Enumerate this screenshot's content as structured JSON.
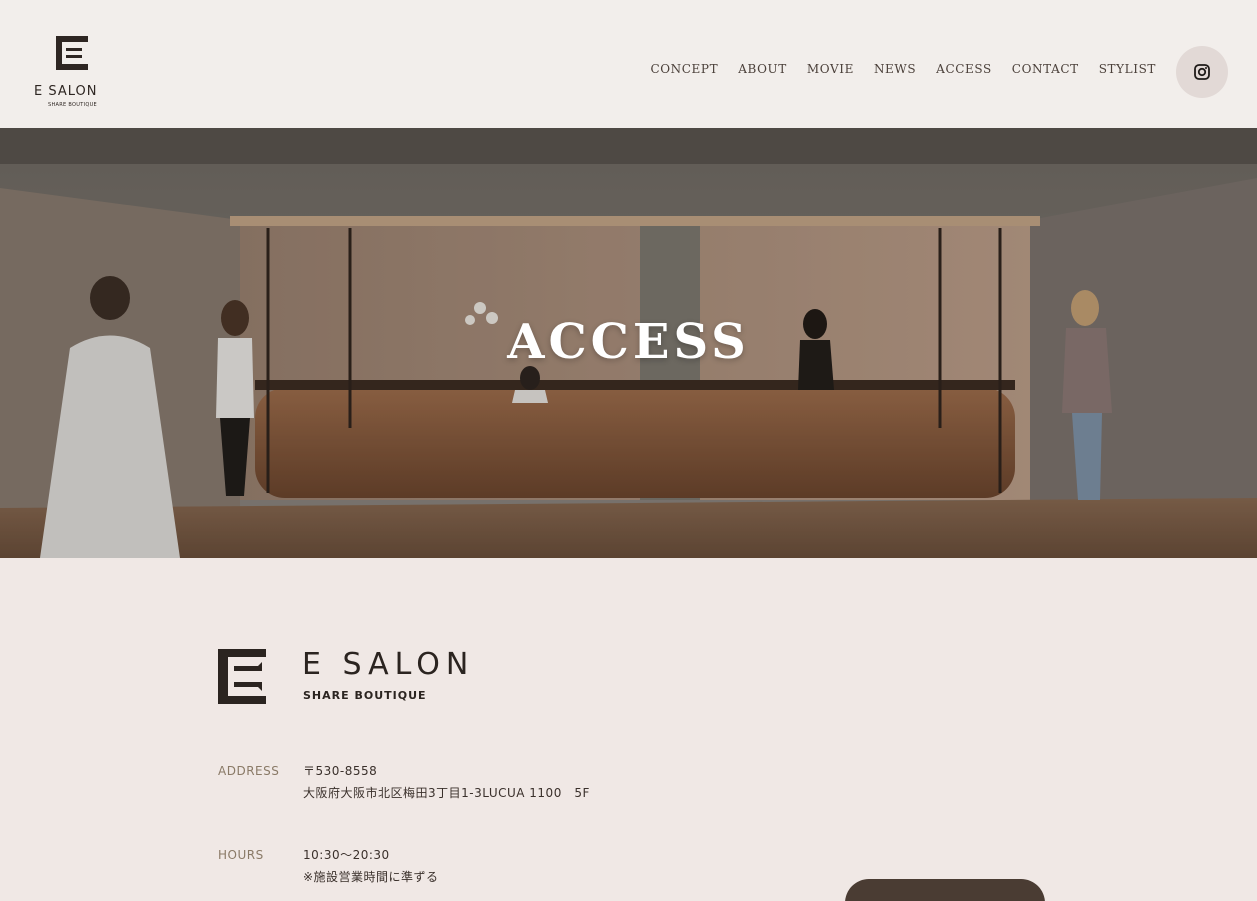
{
  "header": {
    "logo": {
      "name": "E SALON",
      "sub": "SHARE BOUTIQUE"
    },
    "nav": [
      {
        "label": "CONCEPT"
      },
      {
        "label": "ABOUT"
      },
      {
        "label": "MOVIE"
      },
      {
        "label": "NEWS"
      },
      {
        "label": "ACCESS"
      },
      {
        "label": "CONTACT"
      },
      {
        "label": "STYLIST"
      }
    ],
    "social_icon": "instagram-icon"
  },
  "hero": {
    "title": "ACCESS"
  },
  "access": {
    "logo": {
      "name": "E SALON",
      "sub": "SHARE BOUTIQUE"
    },
    "address": {
      "label": "ADDRESS",
      "postal": "〒530-8558",
      "line": "大阪府大阪市北区梅田3丁目1-3LUCUA 1100　5F"
    },
    "hours": {
      "label": "HOURS",
      "time": "10:30〜20:30",
      "note": "※施設営業時間に準ずる"
    }
  },
  "colors": {
    "background": "#f1ebe8",
    "accent": "#4a3c33",
    "label": "#8a7a67"
  }
}
